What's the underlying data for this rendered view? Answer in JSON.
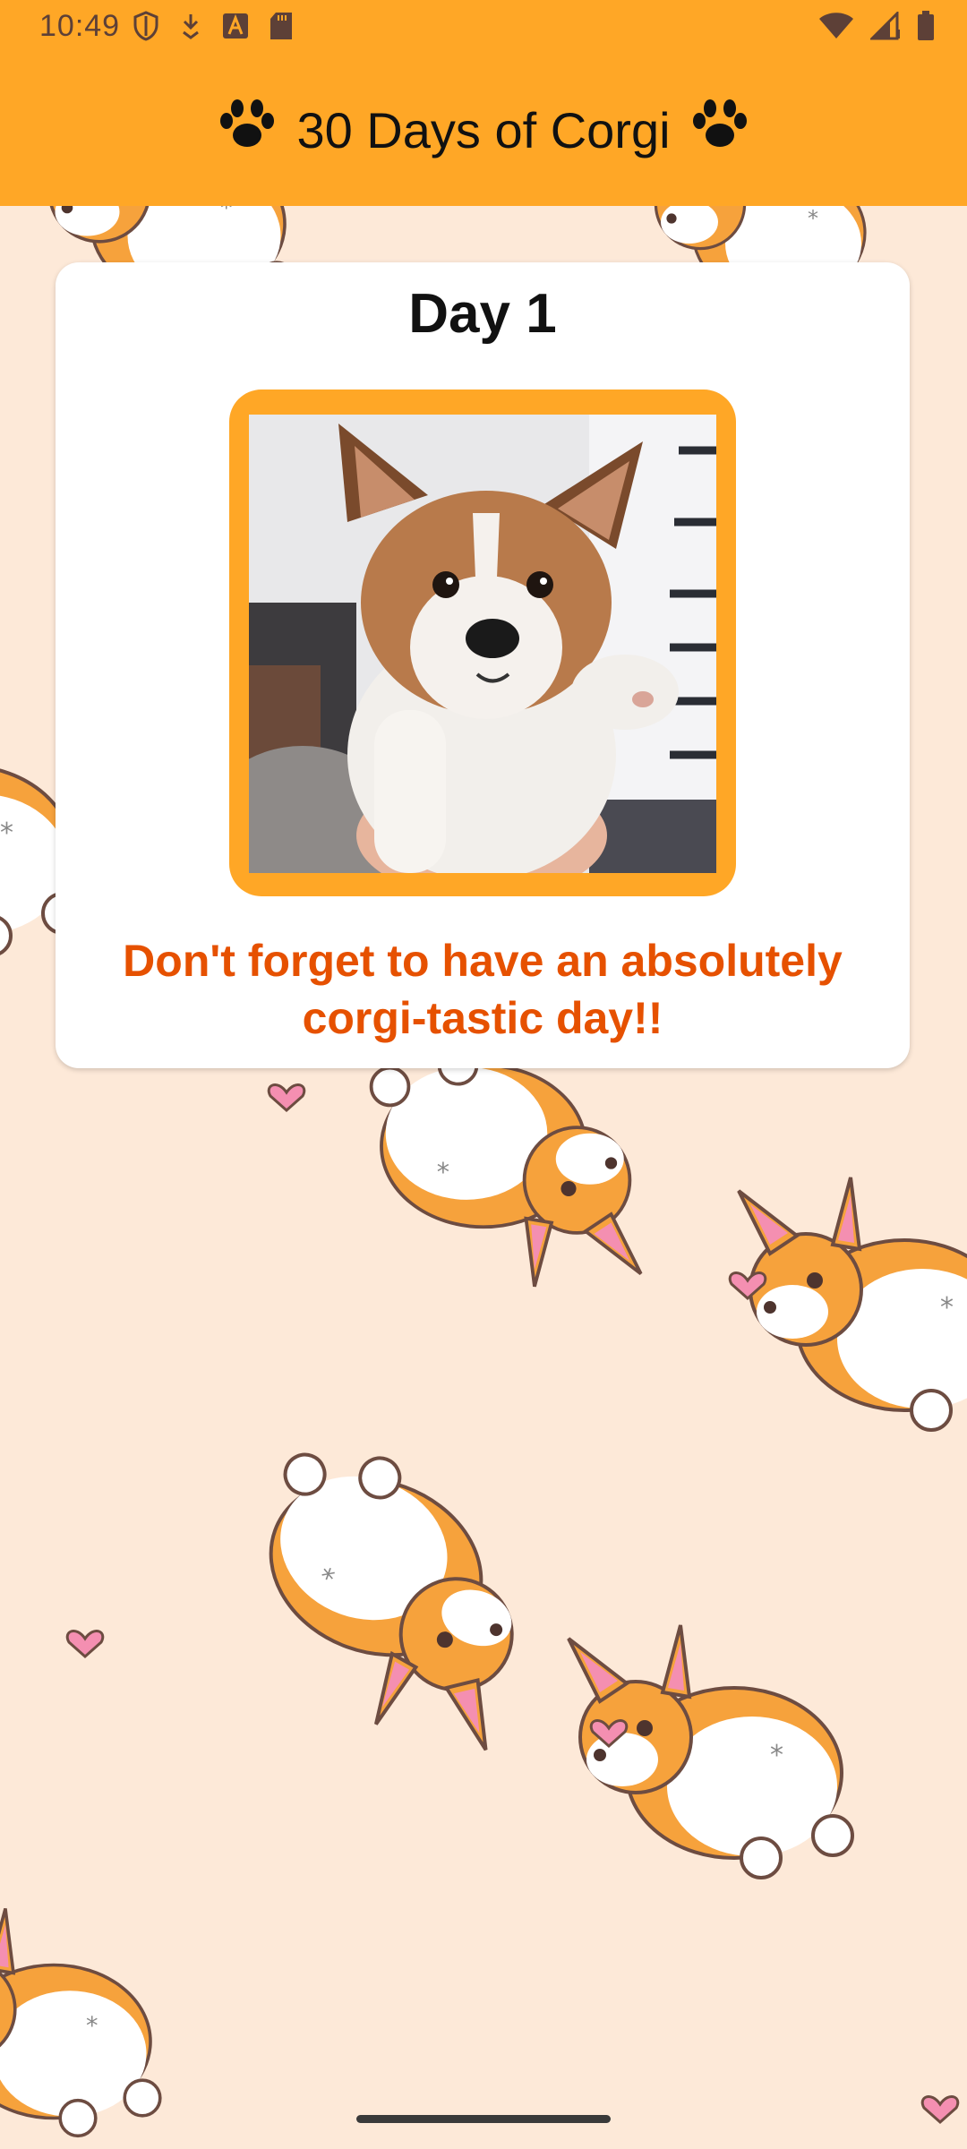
{
  "status_bar": {
    "time": "10:49",
    "left_icons": [
      "shield-icon",
      "download-icon",
      "font-a-icon",
      "sd-card-icon"
    ],
    "right_icons": [
      "wifi-icon",
      "signal-icon",
      "battery-icon"
    ]
  },
  "app_bar": {
    "title": "30 Days of Corgi",
    "left_icon": "paw-icon",
    "right_icon": "paw-icon"
  },
  "card": {
    "title": "Day 1",
    "image": "corgi-puppy-photo",
    "message": "Don't forget to have an absolutely corgi-tastic day!!"
  },
  "colors": {
    "app_bar": "#ffa726",
    "frame": "#ffa726",
    "message": "#e65100",
    "background": "#fde9d8"
  }
}
